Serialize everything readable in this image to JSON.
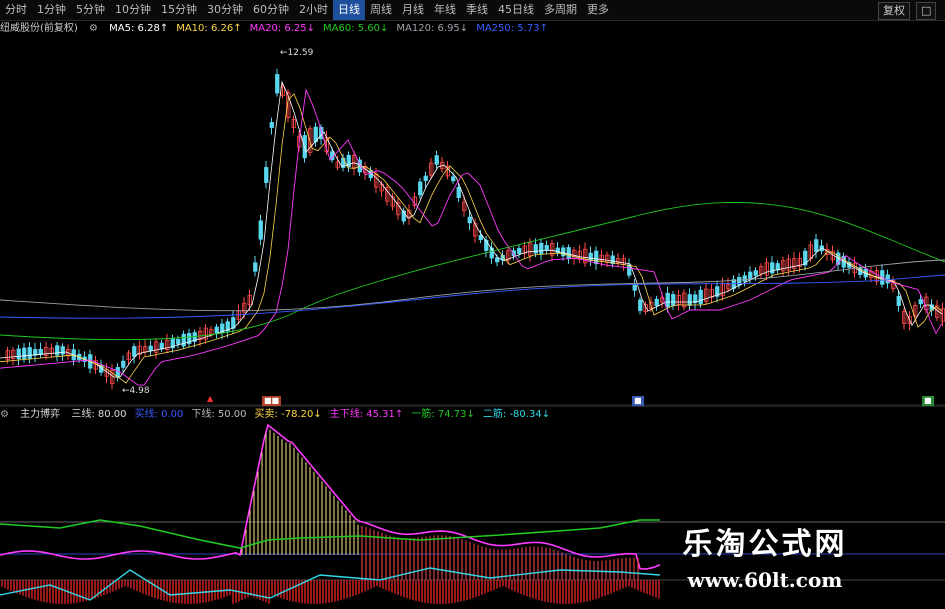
{
  "toolbar": {
    "periods": [
      "分时",
      "1分钟",
      "5分钟",
      "10分钟",
      "15分钟",
      "30分钟",
      "60分钟",
      "2小时",
      "日线",
      "周线",
      "月线",
      "年线",
      "季线",
      "45日线",
      "多周期"
    ],
    "active_period": "日线",
    "more_label": "更多",
    "right_buttons": [
      "复权",
      "□"
    ]
  },
  "price_panel": {
    "name": "纽威股份(前复权)",
    "ma_items": [
      {
        "label": "MA5: 6.28",
        "arrow": "↑",
        "color": "#ffffff"
      },
      {
        "label": "MA10: 6.26",
        "arrow": "↑",
        "color": "#ffd84a"
      },
      {
        "label": "MA20: 6.25",
        "arrow": "↓",
        "color": "#ff3bff"
      },
      {
        "label": "MA60: 5.60",
        "arrow": "↓",
        "color": "#22c922"
      },
      {
        "label": "MA120: 6.95",
        "arrow": "↓",
        "color": "#9aa0a6"
      },
      {
        "label": "MA250: 5.73",
        "arrow": "↑",
        "color": "#3b5bff"
      }
    ],
    "high_label": "12.59",
    "low_label": "4.98"
  },
  "indicator_panel": {
    "title": "主力博弈",
    "items": [
      {
        "label": "三线: 80.00",
        "color": "#dddddd"
      },
      {
        "label": "买线: 0.00",
        "color": "#3b5bff"
      },
      {
        "label": "下线: 50.00",
        "color": "#bbbbbb"
      },
      {
        "label": "买卖: -78.20",
        "arrow": "↓",
        "color": "#ffd84a"
      },
      {
        "label": "主下线: 45.31",
        "arrow": "↑",
        "color": "#ff3bff"
      },
      {
        "label": "一筋: 74.73",
        "arrow": "↓",
        "color": "#22c922"
      },
      {
        "label": "二筋: -80.34",
        "arrow": "↓",
        "color": "#33d6e6"
      }
    ]
  },
  "watermark": {
    "title": "乐淘公式网",
    "url": "www.60lt.com"
  },
  "colors": {
    "up": "#ff4a4a",
    "down": "#5ad6ee",
    "background": "#000000",
    "active_tab": "#1e4f9c"
  }
}
